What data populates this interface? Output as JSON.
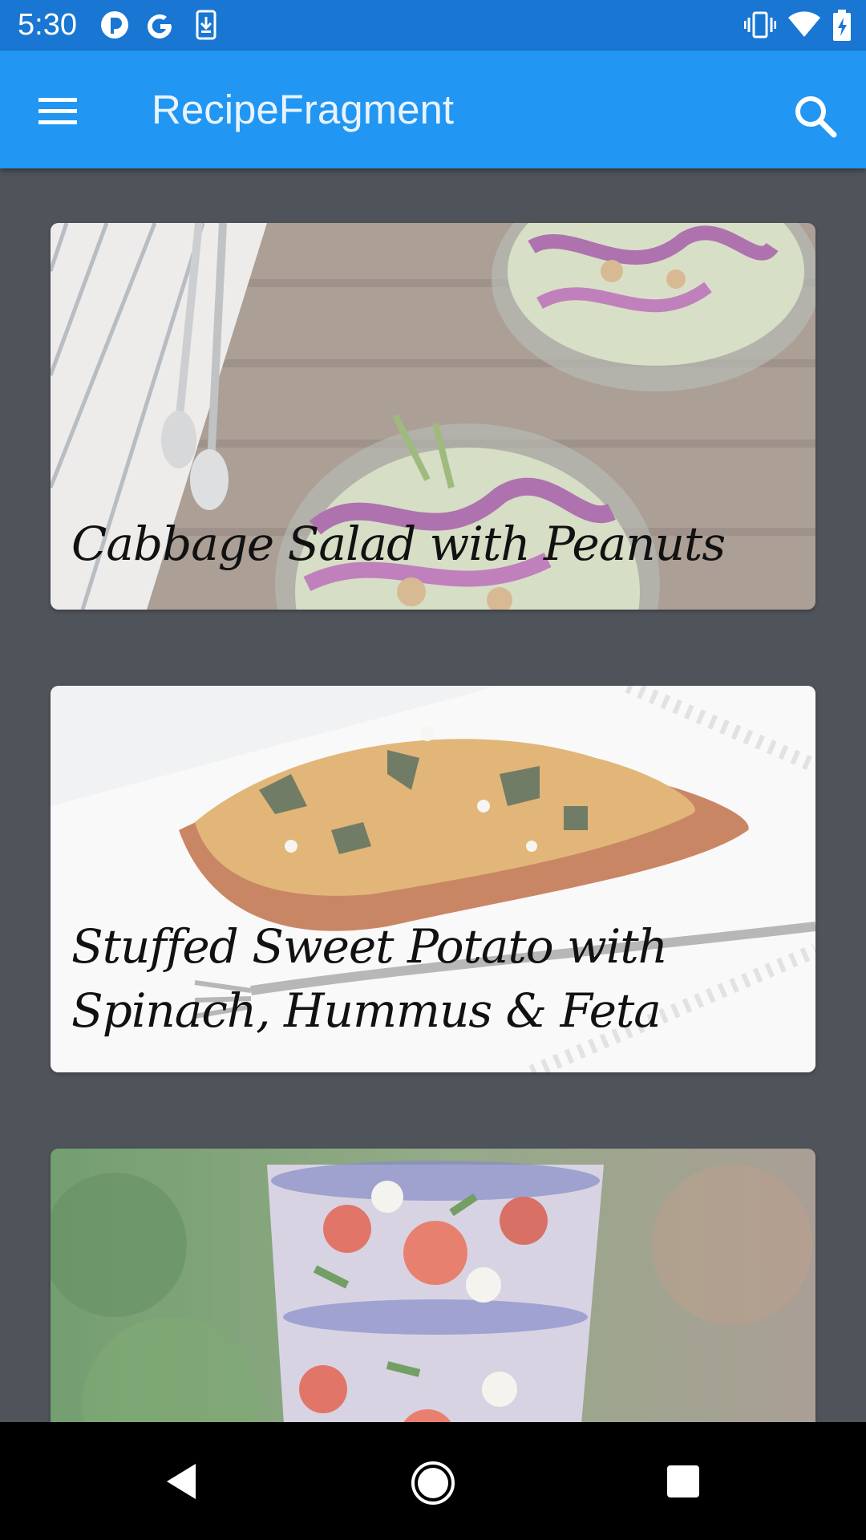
{
  "status_bar": {
    "time": "5:30",
    "left_icons": [
      "pocket-casts-icon",
      "google-icon",
      "download-icon"
    ],
    "right_icons": [
      "vibrate-icon",
      "wifi-icon",
      "battery-charging-icon"
    ]
  },
  "app_bar": {
    "title": "RecipeFragment",
    "menu_icon": "hamburger-menu-icon",
    "search_icon": "search-icon",
    "color": "#2196f3"
  },
  "recipes": [
    {
      "title": "Cabbage Salad with Peanuts"
    },
    {
      "title": "Stuffed Sweet Potato with Spinach, Hummus & Feta"
    },
    {
      "title": ""
    }
  ],
  "nav_bar": {
    "back_icon": "back-triangle-icon",
    "home_icon": "home-circle-icon",
    "recents_icon": "recents-square-icon"
  }
}
